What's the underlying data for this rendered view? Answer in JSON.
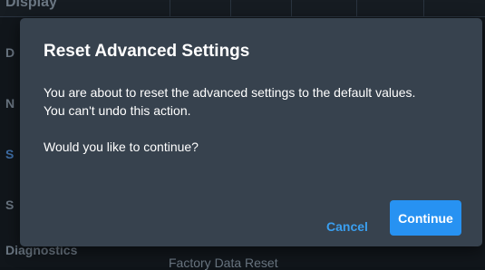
{
  "background": {
    "top_heading": "Display",
    "side_letters": [
      "D",
      "N",
      "S",
      "S"
    ],
    "bottom_left_heading": "Diagnostics",
    "bottom_label": "Factory Data Reset"
  },
  "dialog": {
    "title": "Reset Advanced Settings",
    "line1": "You are about to reset the advanced settings to the default values.",
    "line2": "You can't undo this action.",
    "question": "Would you like to continue?",
    "cancel_label": "Cancel",
    "continue_label": "Continue"
  },
  "colors": {
    "dialog_bg": "#37424e",
    "accent": "#2792f2",
    "link": "#3a9ff0"
  }
}
